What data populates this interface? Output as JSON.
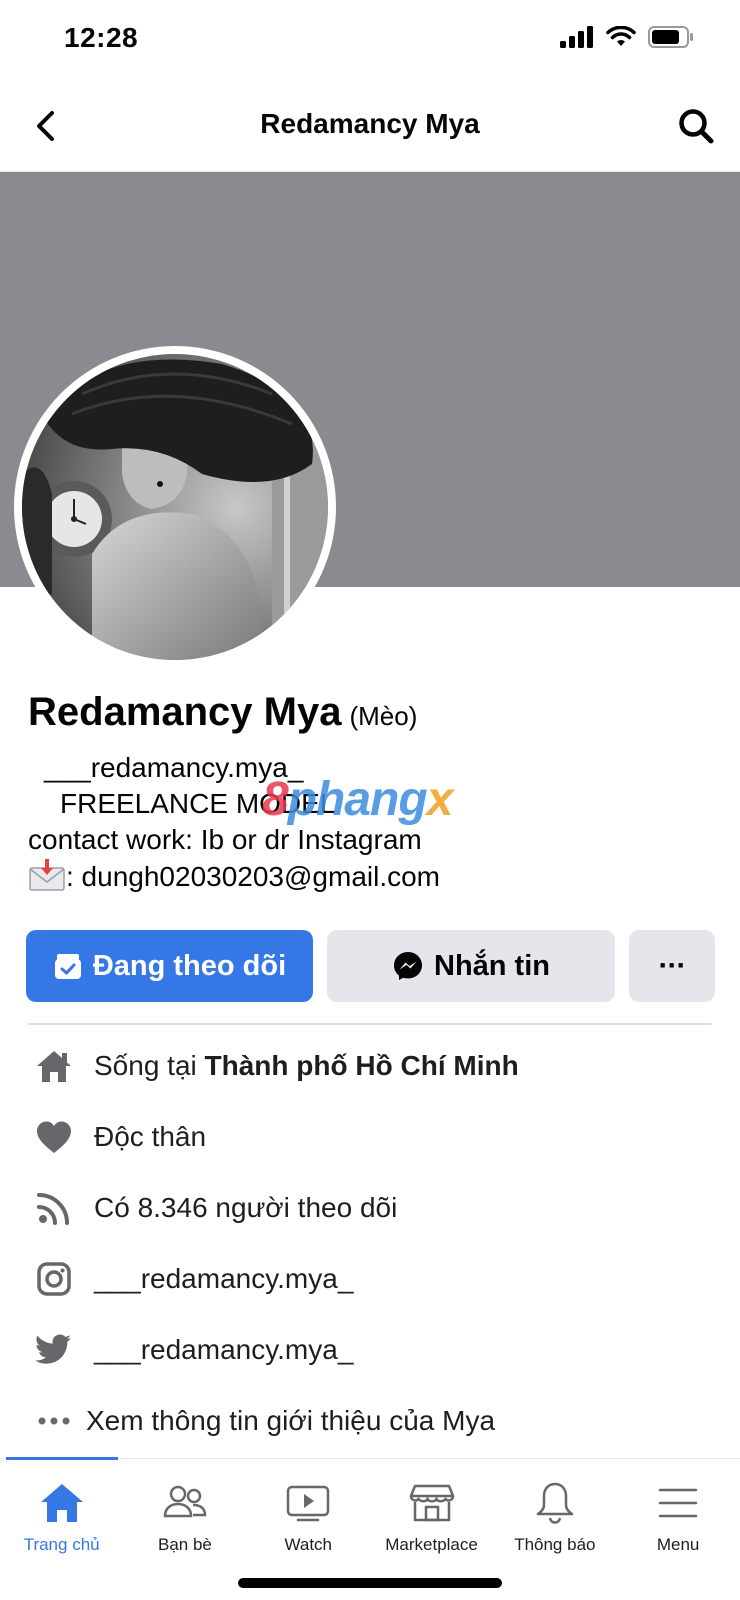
{
  "status_bar": {
    "time": "12:28"
  },
  "header": {
    "title": "Redamancy Mya"
  },
  "profile": {
    "name": "Redamancy Mya",
    "alt_name": "(Mèo)",
    "bio": {
      "line1": "___redamancy.mya_",
      "line2": "FREELANCE MODEL",
      "line3": "contact work: Ib or dr Instagram",
      "email_line": ": dungh02030203@gmail.com"
    }
  },
  "watermark": {
    "part1": "8",
    "part2": "phang",
    "part3": "x"
  },
  "actions": {
    "follow_label": "Đang theo dõi",
    "message_label": "Nhắn tin",
    "more_label": "···"
  },
  "details": {
    "lives_prefix": "Sống tại ",
    "lives_city": "Thành phố Hồ Chí Minh",
    "relationship": "Độc thân",
    "followers": "Có 8.346 người theo dõi",
    "instagram": "___redamancy.mya_",
    "twitter": "___redamancy.mya_",
    "see_more": "Xem thông tin giới thiệu của Mya"
  },
  "tab_bar": {
    "tabs": [
      {
        "label": "Trang chủ",
        "icon": "home-icon",
        "active": true
      },
      {
        "label": "Bạn bè",
        "icon": "friends-icon",
        "active": false
      },
      {
        "label": "Watch",
        "icon": "watch-icon",
        "active": false
      },
      {
        "label": "Marketplace",
        "icon": "marketplace-icon",
        "active": false
      },
      {
        "label": "Thông báo",
        "icon": "bell-icon",
        "active": false
      },
      {
        "label": "Menu",
        "icon": "menu-icon",
        "active": false
      }
    ]
  },
  "colors": {
    "accent": "#3578e5",
    "cover": "#8a8b90",
    "button_gray": "#e4e6eb"
  }
}
